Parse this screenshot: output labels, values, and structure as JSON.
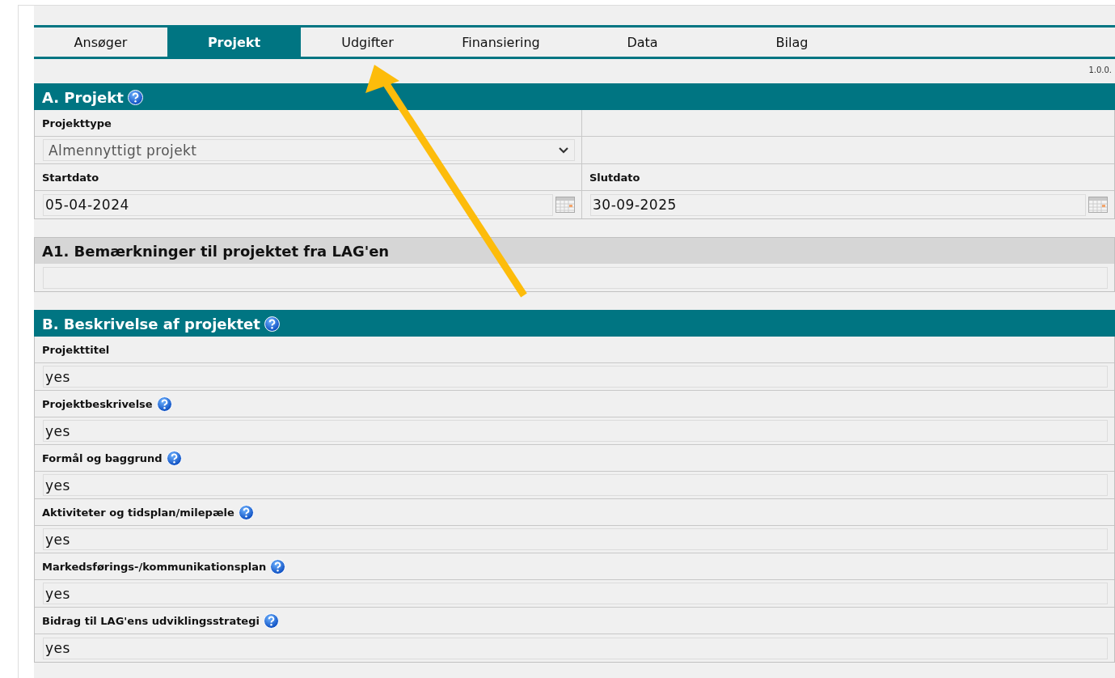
{
  "tabs": [
    {
      "label": "Ansøger",
      "selected": false
    },
    {
      "label": "Projekt",
      "selected": true
    },
    {
      "label": "Udgifter",
      "selected": false
    },
    {
      "label": "Finansiering",
      "selected": false
    },
    {
      "label": "Data",
      "selected": false
    },
    {
      "label": "Bilag",
      "selected": false
    }
  ],
  "version": "1.0.0.",
  "sections": [
    {
      "title": "A. Projekt",
      "help": true,
      "kind": "grid",
      "rows": [
        [
          {
            "label": "Projekttype",
            "kind": "select",
            "value": "Almennyttigt projekt"
          },
          {
            "kind": "empty"
          }
        ],
        [
          {
            "label": "Startdato",
            "kind": "date",
            "value": "05-04-2024"
          },
          {
            "label": "Slutdato",
            "kind": "date",
            "value": "30-09-2025"
          }
        ]
      ]
    },
    {
      "title": "A1. Bemærkninger til projektet fra LAG'en",
      "help": false,
      "kind": "remarks",
      "fields": [
        {
          "kind": "text"
        }
      ]
    },
    {
      "title": "B. Beskrivelse af projektet",
      "help": true,
      "kind": "list",
      "fields": [
        {
          "label": "Projekttitel",
          "help": false,
          "kind": "text",
          "value": "yes"
        },
        {
          "label": "Projektbeskrivelse",
          "help": true,
          "kind": "text",
          "value": "yes"
        },
        {
          "label": "Formål og baggrund",
          "help": true,
          "kind": "text",
          "value": "yes"
        },
        {
          "label": "Aktiviteter og tidsplan/milepæle",
          "help": true,
          "kind": "text",
          "value": "yes"
        },
        {
          "label": "Markedsførings-/kommunikationsplan",
          "help": true,
          "kind": "text",
          "value": "yes"
        },
        {
          "label": "Bidrag til LAG'ens udviklingsstrategi",
          "help": true,
          "kind": "text",
          "value": "yes"
        }
      ]
    }
  ]
}
